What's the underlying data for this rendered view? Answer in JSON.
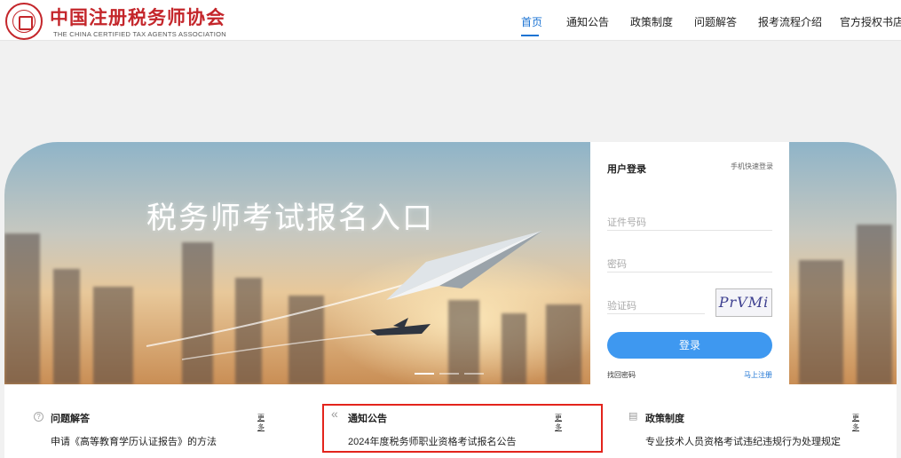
{
  "header": {
    "org_name_cn": "中国注册税务师协会",
    "org_name_en": "THE CHINA CERTIFIED TAX AGENTS ASSOCIATION",
    "logo_icon": "association-seal-icon"
  },
  "nav": {
    "items": [
      {
        "label": "首页",
        "active": true
      },
      {
        "label": "通知公告"
      },
      {
        "label": "政策制度"
      },
      {
        "label": "问题解答"
      },
      {
        "label": "报考流程介绍"
      },
      {
        "label": "官方授权书店"
      }
    ],
    "active_color": "#1b73d3"
  },
  "banner": {
    "title": "税务师考试报名入口",
    "slides": 3,
    "active_slide": 1
  },
  "login": {
    "title": "用户登录",
    "alt_login": "手机快速登录",
    "id_placeholder": "证件号码",
    "password_placeholder": "密码",
    "captcha_placeholder": "验证码",
    "captcha_text": "PrVMi",
    "submit_label": "登录",
    "forgot_label": "找回密码",
    "register_label": "马上注册",
    "button_color": "#3e98f0"
  },
  "sections": [
    {
      "icon": "question-circle-icon",
      "icon_glyph": "?",
      "title": "问题解答",
      "more": "更多",
      "item": "申请《高等教育学历认证报告》的方法"
    },
    {
      "icon": "double-chevron-left-icon",
      "icon_glyph": "«",
      "title": "通知公告",
      "more": "更多",
      "item": "2024年度税务师职业资格考试报名公告"
    },
    {
      "icon": "document-stack-icon",
      "icon_glyph": "▤",
      "title": "政策制度",
      "more": "更多",
      "item": "专业技术人员资格考试违纪违规行为处理规定"
    }
  ],
  "colors": {
    "brand_red": "#c4262b",
    "highlight_red": "#e3241c"
  }
}
